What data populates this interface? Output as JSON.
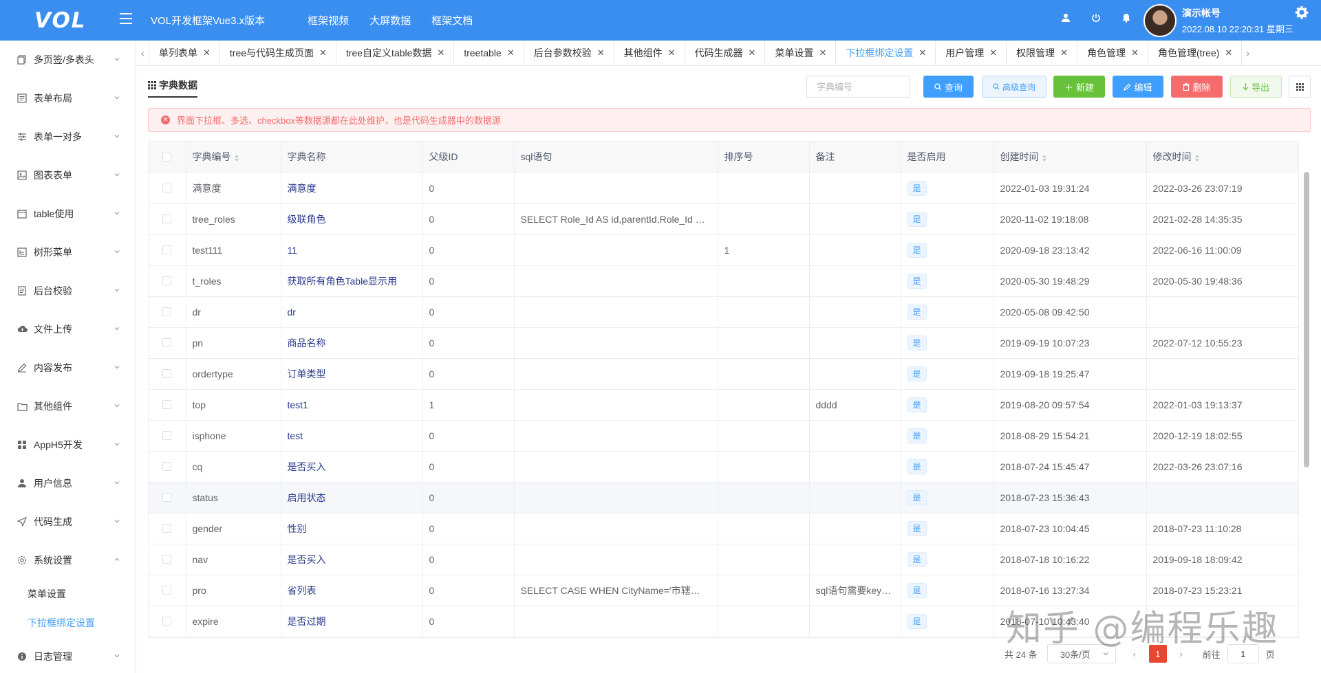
{
  "header": {
    "logo": "VOL",
    "app_title": "VOL开发框架Vue3.x版本",
    "nav": [
      "框架视频",
      "大屏数据",
      "框架文档"
    ],
    "user_name": "演示帐号",
    "datetime": "2022.08.10 22:20:31 星期三"
  },
  "sidebar": {
    "items": [
      {
        "label": "多页签/多表头",
        "icon": "copy-icon"
      },
      {
        "label": "表单布局",
        "icon": "form-icon"
      },
      {
        "label": "表单一对多",
        "icon": "sliders-icon"
      },
      {
        "label": "图表表单",
        "icon": "image-icon"
      },
      {
        "label": "table使用",
        "icon": "calendar-icon"
      },
      {
        "label": "树形菜单",
        "icon": "tree-icon"
      },
      {
        "label": "后台校验",
        "icon": "document-icon"
      },
      {
        "label": "文件上传",
        "icon": "cloud-upload-icon"
      },
      {
        "label": "内容发布",
        "icon": "edit-icon"
      },
      {
        "label": "其他组件",
        "icon": "folder-icon"
      },
      {
        "label": "AppH5开发",
        "icon": "grid-icon"
      },
      {
        "label": "用户信息",
        "icon": "user-icon"
      },
      {
        "label": "代码生成",
        "icon": "send-icon"
      },
      {
        "label": "系统设置",
        "icon": "gear-icon"
      }
    ],
    "sub_items": [
      {
        "label": "菜单设置",
        "active": false
      },
      {
        "label": "下拉框绑定设置",
        "active": true
      }
    ],
    "last_item": {
      "label": "日志管理",
      "icon": "info-icon"
    }
  },
  "tabs": [
    {
      "label": "单列表单",
      "active": false
    },
    {
      "label": "tree与代码生成页面",
      "active": false
    },
    {
      "label": "tree自定义table数据",
      "active": false
    },
    {
      "label": "treetable",
      "active": false
    },
    {
      "label": "后台参数校验",
      "active": false
    },
    {
      "label": "其他组件",
      "active": false
    },
    {
      "label": "代码生成器",
      "active": false
    },
    {
      "label": "菜单设置",
      "active": false
    },
    {
      "label": "下拉框绑定设置",
      "active": true
    },
    {
      "label": "用户管理",
      "active": false
    },
    {
      "label": "权限管理",
      "active": false
    },
    {
      "label": "角色管理",
      "active": false
    },
    {
      "label": "角色管理(tree)",
      "active": false
    }
  ],
  "toolbar": {
    "title": "字典数据",
    "search_placeholder": "字典编号",
    "query": "查询",
    "advanced": "高级查询",
    "new": "新建",
    "edit": "编辑",
    "delete": "删除",
    "export": "导出"
  },
  "alert": "界面下拉框、多选、checkbox等数据源都在此处维护，也是代码生成器中的数据源",
  "table": {
    "columns": [
      "字典编号",
      "字典名称",
      "父级ID",
      "sql语句",
      "排序号",
      "备注",
      "是否启用",
      "创建时间",
      "修改时间"
    ],
    "sortable": [
      true,
      false,
      false,
      false,
      false,
      false,
      false,
      true,
      true
    ],
    "rows": [
      [
        "满意度",
        "满意度",
        "0",
        "",
        "",
        "",
        "是",
        "2022-01-03 19:31:24",
        "2022-03-26 23:07:19"
      ],
      [
        "tree_roles",
        "级联角色",
        "0",
        "SELECT Role_Id AS id,parentId,Role_Id …",
        "",
        "",
        "是",
        "2020-11-02 19:18:08",
        "2021-02-28 14:35:35"
      ],
      [
        "test111",
        "11",
        "0",
        "",
        "1",
        "",
        "是",
        "2020-09-18 23:13:42",
        "2022-06-16 11:00:09"
      ],
      [
        "t_roles",
        "获取所有角色Table显示用",
        "0",
        "",
        "",
        "",
        "是",
        "2020-05-30 19:48:29",
        "2020-05-30 19:48:36"
      ],
      [
        "dr",
        "dr",
        "0",
        "",
        "",
        "",
        "是",
        "2020-05-08 09:42:50",
        ""
      ],
      [
        "pn",
        "商品名称",
        "0",
        "",
        "",
        "",
        "是",
        "2019-09-19 10:07:23",
        "2022-07-12 10:55:23"
      ],
      [
        "ordertype",
        "订单类型",
        "0",
        "",
        "",
        "",
        "是",
        "2019-09-18 19:25:47",
        ""
      ],
      [
        "top",
        "test1",
        "1",
        "",
        "",
        "dddd",
        "是",
        "2019-08-20 09:57:54",
        "2022-01-03 19:13:37"
      ],
      [
        "isphone",
        "test",
        "0",
        "",
        "",
        "",
        "是",
        "2018-08-29 15:54:21",
        "2020-12-19 18:02:55"
      ],
      [
        "cq",
        "是否买入",
        "0",
        "",
        "",
        "",
        "是",
        "2018-07-24 15:45:47",
        "2022-03-26 23:07:16"
      ],
      [
        "status",
        "启用状态",
        "0",
        "",
        "",
        "",
        "是",
        "2018-07-23 15:36:43",
        ""
      ],
      [
        "gender",
        "性别",
        "0",
        "",
        "",
        "",
        "是",
        "2018-07-23 10:04:45",
        "2018-07-23 11:10:28"
      ],
      [
        "nav",
        "是否买入",
        "0",
        "",
        "",
        "",
        "是",
        "2018-07-18 10:16:22",
        "2019-09-18 18:09:42"
      ],
      [
        "pro",
        "省列表",
        "0",
        "SELECT CASE WHEN CityName='市辖…",
        "",
        "sql语句需要key…",
        "是",
        "2018-07-16 13:27:34",
        "2018-07-23 15:23:21"
      ],
      [
        "expire",
        "是否过期",
        "0",
        "",
        "",
        "",
        "是",
        "2018-07-10 10:43:40",
        ""
      ]
    ]
  },
  "pagination": {
    "total": "共 24 条",
    "page_size": "30条/页",
    "current": "1",
    "goto_label": "前往",
    "goto_value": "1",
    "page_suffix": "页"
  },
  "watermark": "知乎 @编程乐趣",
  "colors": {
    "header": "#3a8ef0",
    "primary": "#409eff",
    "success": "#67c23a",
    "danger": "#f56c6c",
    "current_page": "#e5472f"
  }
}
